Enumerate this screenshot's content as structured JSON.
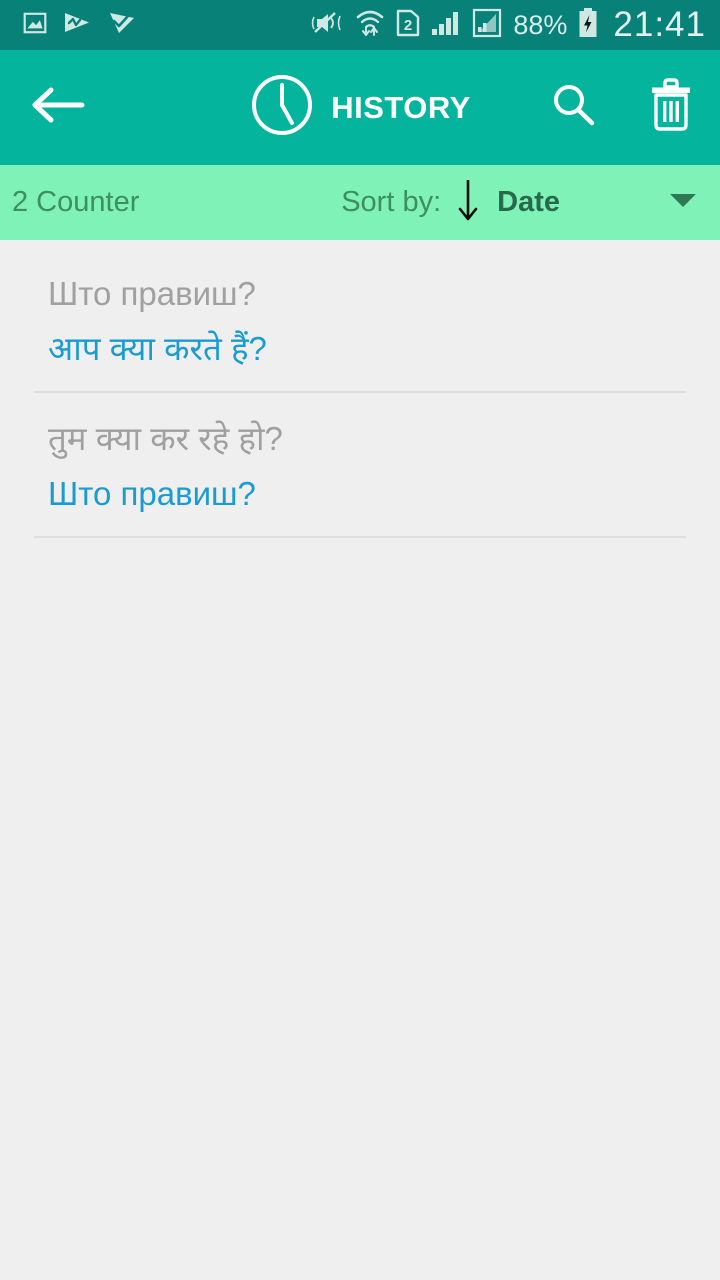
{
  "status_bar": {
    "background": "#088179",
    "left_icons": [
      {
        "name": "gallery-notification-icon",
        "label": "gallery"
      },
      {
        "name": "player-notification-icon",
        "label": "player"
      },
      {
        "name": "check-notification-icon",
        "label": "check"
      }
    ],
    "right_icons": [
      {
        "name": "mute-vibrate-icon",
        "label": "mute"
      },
      {
        "name": "wifi-transfer-icon",
        "label": "wifi"
      },
      {
        "name": "sim-card-icon",
        "label": "2"
      },
      {
        "name": "signal-bars-icon",
        "label": "signal"
      },
      {
        "name": "mobile-data-icon",
        "label": "data"
      }
    ],
    "battery_percent": "88%",
    "battery_state": "charging",
    "time": "21:41"
  },
  "appbar": {
    "background": "#04b49c",
    "back_icon": "back-arrow-icon",
    "title_icon": "clock-icon",
    "title": "HISTORY",
    "actions": [
      {
        "name": "search-button",
        "icon": "search-icon"
      },
      {
        "name": "delete-button",
        "icon": "trash-icon"
      }
    ]
  },
  "sortbar": {
    "background": "#7ef2b7",
    "counter": "2 Counter",
    "sort_by_label": "Sort by:",
    "sort_direction_icon": "arrow-down-icon",
    "sort_value": "Date",
    "dropdown_icon": "chevron-down-icon"
  },
  "history": {
    "source_color": "#a0a0a0",
    "target_color": "#1a9cd2",
    "items": [
      {
        "source_text": "Што правиш?",
        "target_text": "आप क्या करते हैं?"
      },
      {
        "source_text": "तुम क्या कर रहे हो?",
        "target_text": "Што правиш?"
      }
    ]
  }
}
